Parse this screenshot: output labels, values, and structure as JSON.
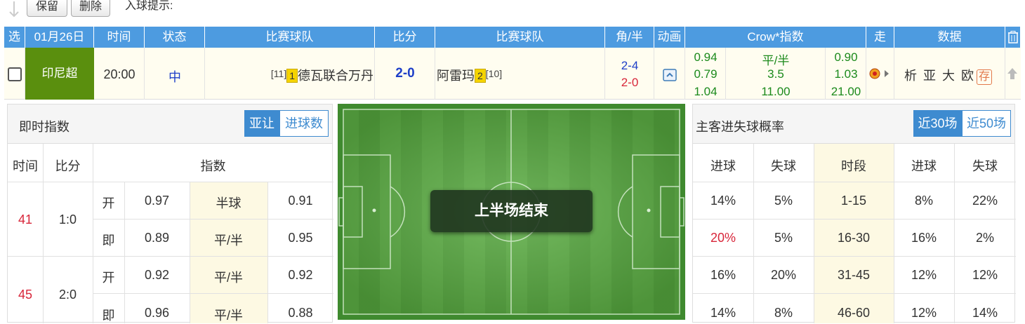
{
  "toolbar": {
    "keep_label": "保留",
    "delete_label": "删除",
    "hint_label": "入球提示:"
  },
  "header": {
    "select": "选",
    "date": "01月26日",
    "time": "时间",
    "status": "状态",
    "home_team": "比赛球队",
    "score": "比分",
    "away_team": "比赛球队",
    "corner_half": "角/半",
    "animation": "动画",
    "odds": "Crow*指数",
    "trend": "走",
    "data": "数据"
  },
  "match": {
    "league": "印尼超",
    "time": "20:00",
    "status": "中",
    "home_rank": "[11]",
    "home_cards": "1",
    "home_name": "德瓦联合万丹",
    "score": "2-0",
    "away_name": "阿雷玛",
    "away_cards": "2",
    "away_rank": "[10]",
    "corners": "2-4",
    "half_score": "2-0",
    "odds": [
      [
        "0.94",
        "平/半",
        "0.90"
      ],
      [
        "0.79",
        "3.5",
        "1.03"
      ],
      [
        "1.04",
        "11.00",
        "21.00"
      ]
    ],
    "data_links": [
      "析",
      "亚",
      "大",
      "欧"
    ],
    "save_label": "存"
  },
  "live_odds": {
    "title": "即时指数",
    "tab_handicap": "亚让",
    "tab_goals": "进球数",
    "columns": [
      "时间",
      "比分",
      "指数"
    ],
    "groups": [
      {
        "time": "41",
        "score": "1:0",
        "rows": [
          [
            "开",
            "0.97",
            "半球",
            "0.91"
          ],
          [
            "即",
            "0.89",
            "平/半",
            "0.95"
          ]
        ]
      },
      {
        "time": "45",
        "score": "2:0",
        "rows": [
          [
            "开",
            "0.92",
            "平/半",
            "0.92"
          ],
          [
            "即",
            "0.96",
            "平/半",
            "0.88"
          ]
        ]
      }
    ]
  },
  "pitch": {
    "overlay": "上半场结束"
  },
  "goal_prob": {
    "title": "主客进失球概率",
    "tab_30": "近30场",
    "tab_50": "近50场",
    "columns": [
      "进球",
      "失球",
      "时段",
      "进球",
      "失球"
    ],
    "rows": [
      [
        "14%",
        "5%",
        "1-15",
        "8%",
        "22%"
      ],
      [
        "20%",
        "5%",
        "16-30",
        "16%",
        "2%"
      ],
      [
        "16%",
        "20%",
        "31-45",
        "12%",
        "12%"
      ],
      [
        "14%",
        "8%",
        "46-60",
        "12%",
        "14%"
      ]
    ]
  },
  "colors": {
    "header_blue": "#4d9be0",
    "league_green": "#5a8f0e",
    "accent_red": "#d8263a",
    "score_blue": "#1e3fc8"
  }
}
